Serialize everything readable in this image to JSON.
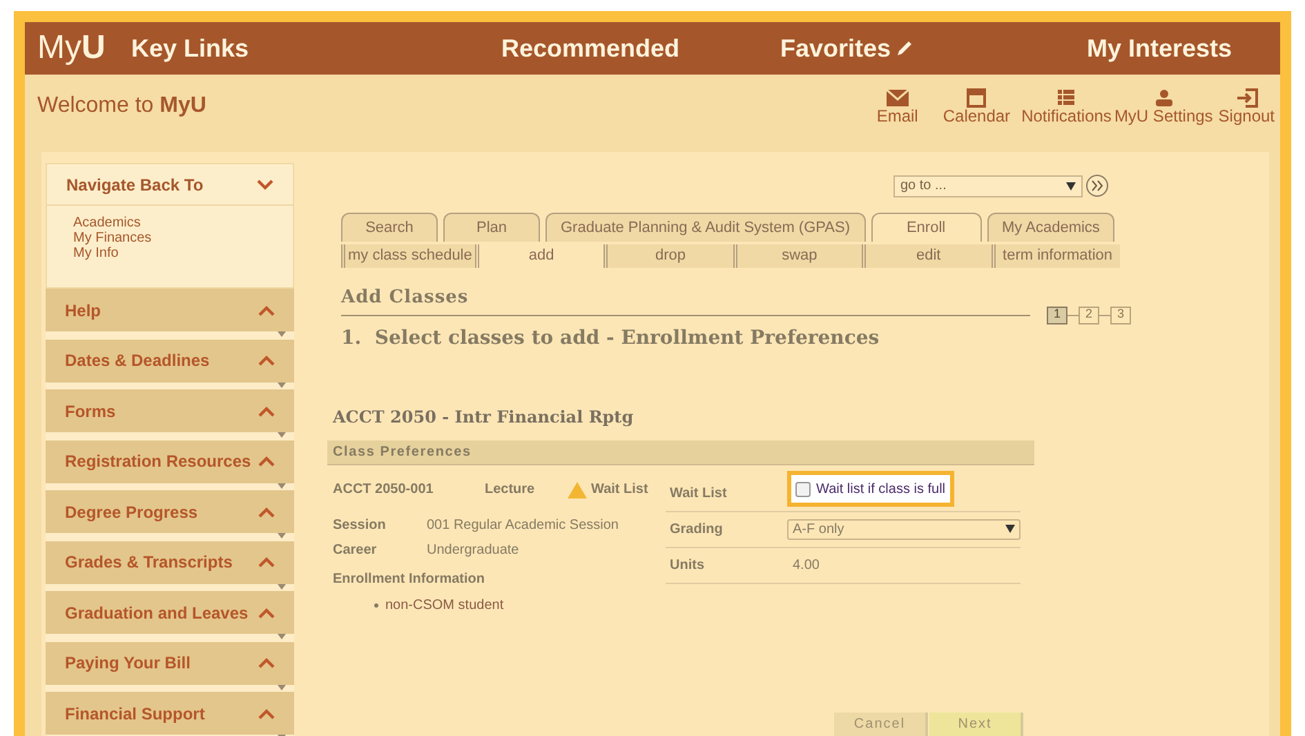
{
  "header": {
    "logo": "My**U**",
    "nav": [
      {
        "label": "Key Links",
        "editable": false
      },
      {
        "label": "Recommended",
        "editable": false
      },
      {
        "label": "Favorites",
        "editable": true
      },
      {
        "label": "My Interests",
        "editable": false
      }
    ]
  },
  "welcome": "Welcome to **MyU**",
  "toolbar": [
    {
      "label": "Email",
      "kind": "email"
    },
    {
      "label": "Calendar",
      "kind": "calendar"
    },
    {
      "label": "Notifications",
      "kind": "notifications"
    },
    {
      "label": "MyU Settings",
      "kind": "settings"
    },
    {
      "label": "Signout",
      "kind": "signout"
    }
  ],
  "sidebar": {
    "nav_back": {
      "title": "Navigate Back To",
      "expanded": true,
      "links": [
        "Academics",
        "My Finances",
        "My Info"
      ]
    },
    "sections": [
      {
        "label": "Help",
        "expanded": false
      },
      {
        "label": "Dates & Deadlines",
        "expanded": false
      },
      {
        "label": "Forms",
        "expanded": false
      },
      {
        "label": "Registration Resources",
        "expanded": false
      },
      {
        "label": "Degree Progress",
        "expanded": false
      },
      {
        "label": "Grades & Transcripts",
        "expanded": false
      },
      {
        "label": "Graduation and Leaves",
        "expanded": false
      },
      {
        "label": "Paying Your Bill",
        "expanded": false
      },
      {
        "label": "Financial Support",
        "expanded": false
      }
    ]
  },
  "goto": {
    "value": "go to ..."
  },
  "tabs": [
    {
      "label": "Search",
      "selected": false
    },
    {
      "label": "Plan",
      "selected": false
    },
    {
      "label": "Graduate Planning & Audit System (GPAS)",
      "selected": false
    },
    {
      "label": "Enroll",
      "selected": true
    },
    {
      "label": "My Academics",
      "selected": false
    }
  ],
  "subtabs": [
    {
      "label": "my class schedule",
      "selected": false
    },
    {
      "label": "add",
      "selected": true
    },
    {
      "label": "drop",
      "selected": false
    },
    {
      "label": "swap",
      "selected": false
    },
    {
      "label": "edit",
      "selected": false
    },
    {
      "label": "term information",
      "selected": false
    }
  ],
  "page_title": "Add Classes",
  "steps": [
    {
      "label": "1",
      "selected": true
    },
    {
      "label": "2",
      "selected": false
    },
    {
      "label": "3",
      "selected": false
    }
  ],
  "step_title": "1.  Select classes to add - Enrollment Preferences",
  "course_title": "ACCT 2050 - Intr Financial Rptg",
  "section_title": "Class Preferences",
  "class_info": {
    "number": "ACCT 2050-001",
    "component": "Lecture",
    "status": "Wait List"
  },
  "details": [
    {
      "label": "Session",
      "value": "001 Regular Academic Session"
    },
    {
      "label": "Career",
      "value": "Undergraduate"
    }
  ],
  "enrollment_info": {
    "label": "Enrollment Information",
    "items": [
      "non-CSOM student"
    ]
  },
  "preferences": [
    {
      "kind": "checkbox",
      "label": "Wait List",
      "option": "Wait list if class is full",
      "checked": false,
      "highlighted": true
    },
    {
      "kind": "select",
      "label": "Grading",
      "value": "A-F only"
    },
    {
      "kind": "text",
      "label": "Units",
      "value": "4.00"
    }
  ],
  "buttons": [
    {
      "label": "Cancel",
      "kind": "secondary"
    },
    {
      "label": "Next",
      "kind": "primary"
    }
  ]
}
